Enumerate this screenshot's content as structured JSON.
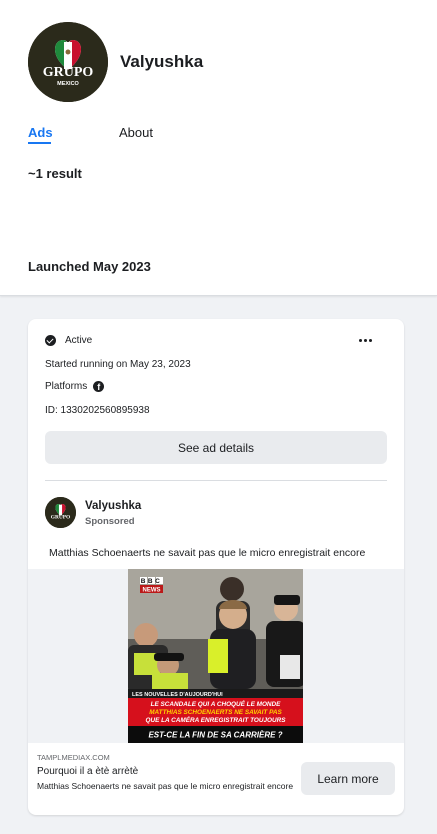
{
  "page": {
    "name": "Valyushka",
    "logo_text": "GRUPO",
    "logo_subtext": "MEXICO"
  },
  "tabs": [
    {
      "label": "Ads",
      "active": true
    },
    {
      "label": "About",
      "active": false
    }
  ],
  "results": {
    "count_label": "~1 result"
  },
  "section": {
    "heading": "Launched May 2023"
  },
  "ad": {
    "status": "Active",
    "started": "Started running on May 23, 2023",
    "platforms_label": "Platforms",
    "platform_icon": "facebook-icon",
    "id": "ID: 1330202560895938",
    "details_button": "See ad details",
    "advertiser": "Valyushka",
    "sponsored_label": "Sponsored",
    "body": "Matthias Schoenaerts ne savait pas que le micro enregistrait encore",
    "creative": {
      "news_brand": "BBC",
      "news_brand_sub": "NEWS",
      "kicker": "LES NOUVELLES D'AUJOURD'HUI",
      "headline_line1": "LE SCANDALE QUI A CHOQUÉ LE MONDE",
      "headline_line2": "MATTHIAS SCHOENAERTS NE SAVAIT PAS",
      "headline_line3": "QUE LA CAMÉRA ENREGISTRAIT TOUJOURS",
      "question": "EST-CE LA FIN DE SA CARRIÈRE ?"
    },
    "footer": {
      "domain": "TAMPLMEDIAX.COM",
      "title": "Pourquoi il a ètè arrètè",
      "description": "Matthias Schoenaerts ne savait pas que le micro enregistrait encore",
      "cta": "Learn more"
    }
  },
  "colors": {
    "accent": "#1877f2",
    "background": "#f0f2f5",
    "button": "#e9ebee",
    "headline_red": "#d6101c"
  }
}
